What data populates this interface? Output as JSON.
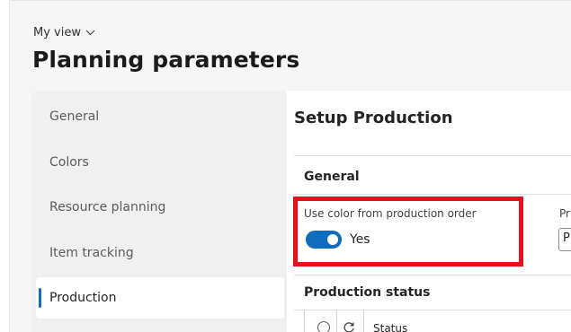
{
  "header": {
    "view_label": "My view",
    "title": "Planning parameters"
  },
  "sidebar": {
    "items": [
      {
        "label": "General",
        "active": false
      },
      {
        "label": "Colors",
        "active": false
      },
      {
        "label": "Resource planning",
        "active": false
      },
      {
        "label": "Item tracking",
        "active": false
      },
      {
        "label": "Production",
        "active": true
      }
    ]
  },
  "main": {
    "section_title": "Setup Production",
    "general_group": {
      "title": "General",
      "use_color_field": {
        "label": "Use color from production order",
        "value": "Yes",
        "enabled": true
      },
      "second_field": {
        "label_visible": "Pr",
        "value_visible": "P"
      }
    },
    "status_group": {
      "title": "Production status",
      "columns": [
        "Status"
      ]
    }
  },
  "colors": {
    "accent": "#0f6cbd",
    "highlight": "#e8101b"
  },
  "icons": [
    "chevron-down-icon",
    "radio-icon",
    "refresh-icon"
  ]
}
